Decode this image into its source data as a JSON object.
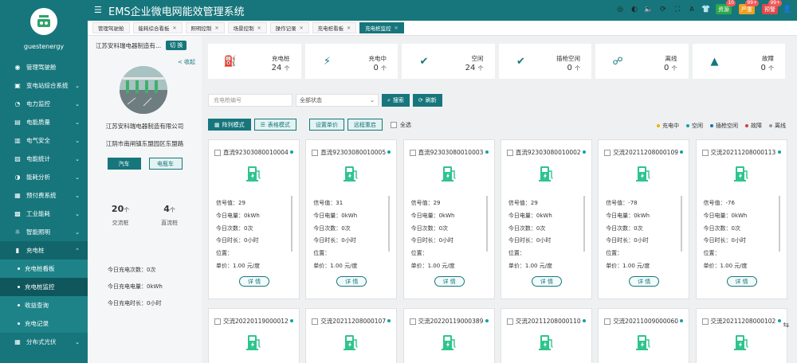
{
  "user": {
    "name": "guestenergy"
  },
  "header": {
    "title": "EMS企业微电网能效管理系统",
    "badges": [
      {
        "label": "资源",
        "count": "10",
        "color": "#2ba84a"
      },
      {
        "label": "严重",
        "count": "99+",
        "color": "#f0a020"
      },
      {
        "label": "预警",
        "count": "99+",
        "color": "#e04848"
      }
    ]
  },
  "tabs": [
    {
      "label": "管理驾驶舱"
    },
    {
      "label": "能耗综合看板"
    },
    {
      "label": "照明控制"
    },
    {
      "label": "场景控制"
    },
    {
      "label": "操作记录"
    },
    {
      "label": "充电桩看板"
    },
    {
      "label": "充电桩监控"
    }
  ],
  "sidebar": {
    "items": [
      {
        "label": "管理驾驶舱",
        "icon": "dashboard-icon",
        "chev": ""
      },
      {
        "label": "变电站综合系统",
        "icon": "substation-icon",
        "chev": "⌄"
      },
      {
        "label": "电力监控",
        "icon": "power-icon",
        "chev": "⌄"
      },
      {
        "label": "电能质量",
        "icon": "quality-icon",
        "chev": "⌄"
      },
      {
        "label": "电气安全",
        "icon": "safety-icon",
        "chev": "⌄"
      },
      {
        "label": "电能统计",
        "icon": "stats-icon",
        "chev": "⌄"
      },
      {
        "label": "能耗分析",
        "icon": "analysis-icon",
        "chev": "⌄"
      },
      {
        "label": "预付费系统",
        "icon": "prepaid-icon",
        "chev": "⌄"
      },
      {
        "label": "工业能耗",
        "icon": "industry-icon",
        "chev": "⌄"
      },
      {
        "label": "智能照明",
        "icon": "light-icon",
        "chev": "⌄"
      },
      {
        "label": "充电桩",
        "icon": "charger-icon",
        "chev": "⌃"
      }
    ],
    "sub": [
      {
        "label": "充电桩看板"
      },
      {
        "label": "充电桩监控"
      },
      {
        "label": "收益查询"
      },
      {
        "label": "充电记录"
      }
    ],
    "after": {
      "label": "分布式光伏",
      "icon": "solar-icon",
      "chev": "⌄"
    }
  },
  "left": {
    "company": "江苏安科瑞电器制造有...",
    "switch_label": "切 换",
    "collapse_label": "< 收起",
    "station_name": "江苏安科瑞电器制造有限公司",
    "station_addr": "江阴市南闸镇东盟园区东盟路",
    "car_btn": "汽车",
    "ebike_btn": "电瓶车",
    "ac_count": "20",
    "ac_unit": "个",
    "ac_label": "交流桩",
    "dc_count": "4",
    "dc_unit": "个",
    "dc_label": "直流桩",
    "today_count": "今日充电次数：0次",
    "today_energy": "今日充电电量：0kWh",
    "today_time": "今日充电时长：0小时"
  },
  "stats": [
    {
      "label": "充电桩",
      "value": "24",
      "unit": "个",
      "icon": "charger-icon",
      "glyph": "⛽"
    },
    {
      "label": "充电中",
      "value": "0",
      "unit": "个",
      "icon": "bolt-icon",
      "glyph": "⚡"
    },
    {
      "label": "空闲",
      "value": "24",
      "unit": "个",
      "icon": "check-circle-icon",
      "glyph": "✔"
    },
    {
      "label": "插枪空闲",
      "value": "0",
      "unit": "个",
      "icon": "check-circle-icon",
      "glyph": "✔"
    },
    {
      "label": "离线",
      "value": "0",
      "unit": "个",
      "icon": "plug-off-icon",
      "glyph": "☍"
    },
    {
      "label": "故障",
      "value": "0",
      "unit": "个",
      "icon": "warning-icon",
      "glyph": "▲"
    }
  ],
  "filters": {
    "pile_placeholder": "充电枪编号",
    "status_value": "全部状态",
    "search_label": "搜索",
    "refresh_label": "刷新"
  },
  "modes": {
    "grid_label": "阵列模式",
    "table_label": "表格模式",
    "price_label": "设置单价",
    "restart_label": "远程重启",
    "select_all": "全选"
  },
  "legend": [
    {
      "label": "充电中",
      "color": "#f0b400"
    },
    {
      "label": "空闲",
      "color": "#16a0a0"
    },
    {
      "label": "插枪空闲",
      "color": "#1e6fa8"
    },
    {
      "label": "故障",
      "color": "#d04040"
    },
    {
      "label": "离线",
      "color": "#999999"
    }
  ],
  "cards": [
    {
      "name": "直流92303080010004",
      "signal": "信号值：29",
      "energy": "今日电量：0kWh",
      "times": "今日次数：0次",
      "duration": "今日时长：0小时",
      "location": "位置：",
      "price": "单价：1.00 元/度",
      "detail": "详 情"
    },
    {
      "name": "直流92303080010005",
      "signal": "信号值：31",
      "energy": "今日电量：0kWh",
      "times": "今日次数：0次",
      "duration": "今日时长：0小时",
      "location": "位置：",
      "price": "单价：1.00 元/度",
      "detail": "详 情"
    },
    {
      "name": "直流92303080010003",
      "signal": "信号值：29",
      "energy": "今日电量：0kWh",
      "times": "今日次数：0次",
      "duration": "今日时长：0小时",
      "location": "位置：",
      "price": "单价：1.00 元/度",
      "detail": "详 情"
    },
    {
      "name": "直流92303080010002",
      "signal": "信号值：29",
      "energy": "今日电量：0kWh",
      "times": "今日次数：0次",
      "duration": "今日时长：0小时",
      "location": "位置：",
      "price": "单价：1.00 元/度",
      "detail": "详 情"
    },
    {
      "name": "交流20211208000109",
      "signal": "信号值：-78",
      "energy": "今日电量：0kWh",
      "times": "今日次数：0次",
      "duration": "今日时长：0小时",
      "location": "位置：",
      "price": "单价：1.00 元/度",
      "detail": "详 情"
    },
    {
      "name": "交流20211208000113",
      "signal": "信号值：-76",
      "energy": "今日电量：0kWh",
      "times": "今日次数：0次",
      "duration": "今日时长：0小时",
      "location": "位置：",
      "price": "单价：1.00 元/度",
      "detail": "详 情"
    }
  ],
  "cards_row2": [
    {
      "name": "交流20220119000012"
    },
    {
      "name": "交流20211208000107"
    },
    {
      "name": "交流20220119000389"
    },
    {
      "name": "交流20211208000110"
    },
    {
      "name": "交流20211009000060"
    },
    {
      "name": "交流20211208000102"
    }
  ],
  "colors": {
    "primary": "#16767c",
    "idle": "#16a0a0",
    "pile": "#2fc48e"
  }
}
